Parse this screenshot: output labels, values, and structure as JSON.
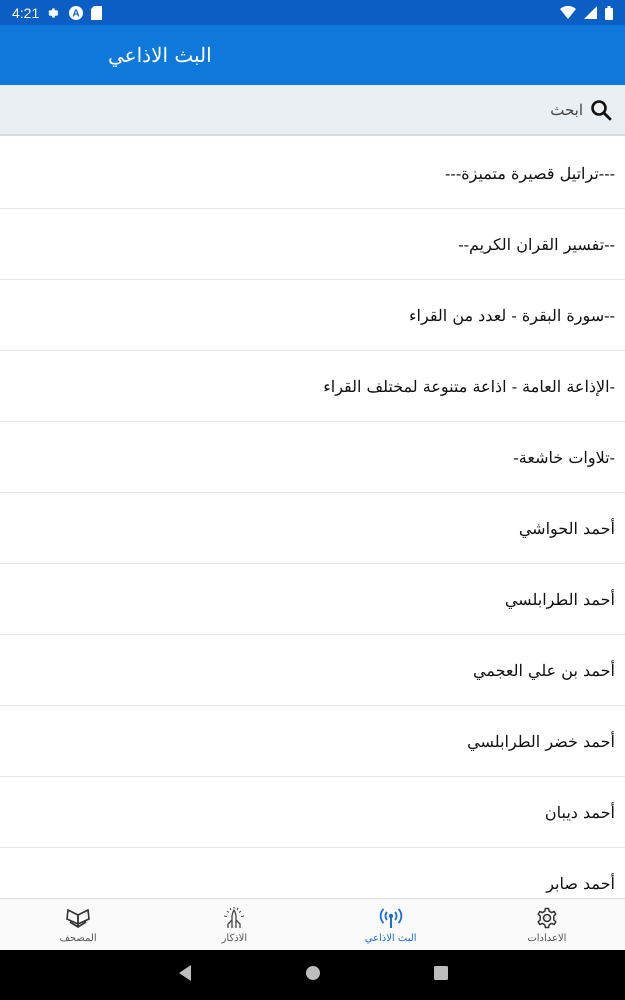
{
  "status_bar": {
    "time": "4:21",
    "icons": [
      "settings-icon",
      "app-notification-icon",
      "sd-card-icon",
      "wifi-icon",
      "signal-icon",
      "battery-icon"
    ]
  },
  "app_bar": {
    "title": "البث الاذاعي"
  },
  "search": {
    "placeholder": "ابحث",
    "icon": "search-icon"
  },
  "list": {
    "items": [
      {
        "label": "---تراتيل قصيرة متميزة---"
      },
      {
        "label": "--تفسير القران الكريم--"
      },
      {
        "label": "--سورة البقرة - لعدد من القراء"
      },
      {
        "label": "-الإذاعة العامة - اذاعة متنوعة لمختلف القراء"
      },
      {
        "label": "-تلاوات خاشعة-"
      },
      {
        "label": "أحمد الحواشي"
      },
      {
        "label": "أحمد الطرابلسي"
      },
      {
        "label": "أحمد بن علي العجمي"
      },
      {
        "label": "أحمد خضر الطرابلسي"
      },
      {
        "label": "أحمد ديبان"
      },
      {
        "label": "أحمد صابر"
      }
    ]
  },
  "bottom_nav": {
    "items": [
      {
        "label": "المصحف",
        "icon": "quran-book-icon"
      },
      {
        "label": "الاذكار",
        "icon": "praying-hands-icon"
      },
      {
        "label": "البث الاذاعي",
        "icon": "broadcast-icon",
        "active": true
      },
      {
        "label": "الاعدادات",
        "icon": "gear-icon"
      }
    ]
  },
  "colors": {
    "status_bar": "#0b5fc4",
    "app_bar": "#0f79db",
    "search_bar": "#e9eff3",
    "active_nav": "#1b6fd0"
  }
}
